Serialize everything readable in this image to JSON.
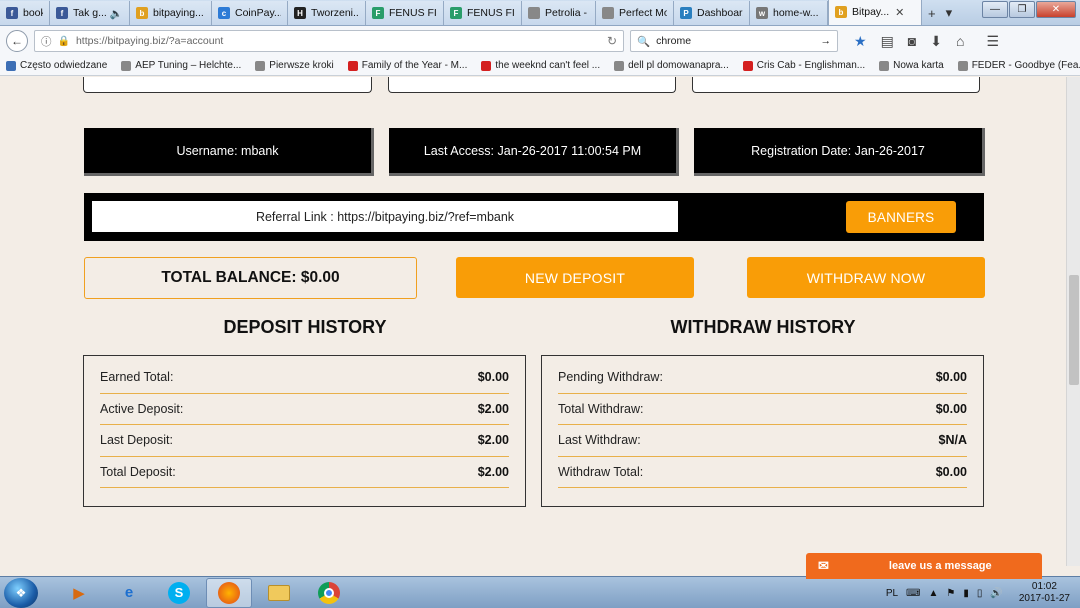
{
  "browser": {
    "tabs": [
      {
        "title": "book",
        "color": "#3b5998",
        "glyph": "f"
      },
      {
        "title": "Tak g...",
        "color": "#3b5998",
        "glyph": "f"
      },
      {
        "title": "bitpaying...",
        "color": "#e0a020",
        "glyph": "b"
      },
      {
        "title": "CoinPay...",
        "color": "#2d7bd6",
        "glyph": "c"
      },
      {
        "title": "Tworzeni...",
        "color": "#222222",
        "glyph": "H"
      },
      {
        "title": "FENUS FI...",
        "color": "#2a9d6a",
        "glyph": "F"
      },
      {
        "title": "FENUS FI...",
        "color": "#2a9d6a",
        "glyph": "F"
      },
      {
        "title": "Petrolia - Con...",
        "color": "#888888",
        "glyph": ""
      },
      {
        "title": "Perfect Mone...",
        "color": "#888888",
        "glyph": ""
      },
      {
        "title": "Dashboar...",
        "color": "#2a7fbf",
        "glyph": "P"
      },
      {
        "title": "home-w...",
        "color": "#777777",
        "glyph": "w"
      },
      {
        "title": "Bitpay...",
        "color": "#e0a020",
        "glyph": "b"
      }
    ],
    "tab_audio_icon": "speaker-icon",
    "url": "https://bitpaying.biz/?a=account",
    "search_value": "chrome",
    "bookmarks": [
      {
        "label": "Często odwiedzane",
        "color": "#3d6fb5"
      },
      {
        "label": "AEP Tuning – Helchte...",
        "color": "#888888"
      },
      {
        "label": "Pierwsze kroki",
        "color": "#888888"
      },
      {
        "label": "Family of the Year - M...",
        "color": "#d42020"
      },
      {
        "label": "the weeknd can't feel ...",
        "color": "#d42020"
      },
      {
        "label": "dell pl domowanapra...",
        "color": "#888888"
      },
      {
        "label": "Cris Cab - Englishman...",
        "color": "#d42020"
      },
      {
        "label": "Nowa karta",
        "color": "#888888"
      },
      {
        "label": "FEDER - Goodbye (Fea...",
        "color": "#888888"
      }
    ]
  },
  "account": {
    "username": "Username: mbank",
    "last_access": "Last Access: Jan-26-2017 11:00:54 PM",
    "registration": "Registration Date: Jan-26-2017",
    "referral": "Referral Link : https://bitpaying.biz/?ref=mbank",
    "banners_label": "BANNERS",
    "total_balance": "TOTAL BALANCE: $0.00",
    "new_deposit_label": "NEW DEPOSIT",
    "withdraw_label": "WITHDRAW NOW"
  },
  "deposit_history": {
    "title": "DEPOSIT HISTORY",
    "rows": [
      {
        "label": "Earned Total:",
        "value": "$0.00"
      },
      {
        "label": "Active Deposit:",
        "value": "$2.00"
      },
      {
        "label": "Last Deposit:",
        "value": "$2.00"
      },
      {
        "label": "Total Deposit:",
        "value": "$2.00"
      }
    ]
  },
  "withdraw_history": {
    "title": "WITHDRAW HISTORY",
    "rows": [
      {
        "label": "Pending Withdraw:",
        "value": "$0.00"
      },
      {
        "label": "Total Withdraw:",
        "value": "$0.00"
      },
      {
        "label": "Last Withdraw:",
        "value": "$N/A"
      },
      {
        "label": "Withdraw Total:",
        "value": "$0.00"
      }
    ]
  },
  "chat": {
    "label": "leave us a message"
  },
  "taskbar": {
    "language": "PL",
    "time": "01:02",
    "date": "2017-01-27"
  },
  "colors": {
    "accent": "#f99d07",
    "chat": "#f06a1d"
  }
}
